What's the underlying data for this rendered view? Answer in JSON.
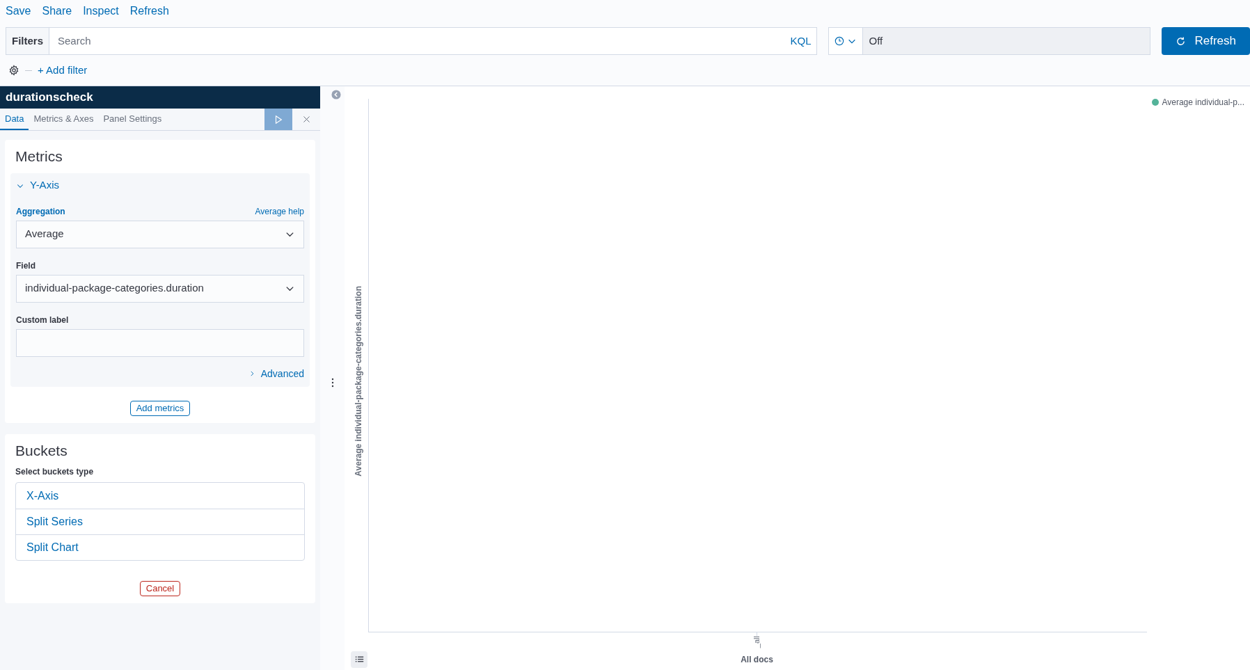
{
  "top_menu": [
    "Save",
    "Share",
    "Inspect",
    "Refresh"
  ],
  "query_bar": {
    "filters_label": "Filters",
    "placeholder": "Search",
    "language": "KQL",
    "refresh_interval": "Off",
    "refresh_button": "Refresh"
  },
  "add_filter": "+ Add filter",
  "editor": {
    "title": "durationscheck",
    "tabs": [
      {
        "label": "Data",
        "selected": true
      },
      {
        "label": "Metrics & Axes",
        "selected": false
      },
      {
        "label": "Panel Settings",
        "selected": false
      }
    ],
    "apply_disabled": true,
    "metrics": {
      "heading": "Metrics",
      "agg_title": "Y-Axis",
      "expanded": true,
      "aggregation_label": "Aggregation",
      "help_link": "Average help",
      "aggregation": "Average",
      "field_label": "Field",
      "field": "individual-package-categories.duration",
      "custom_label_label": "Custom label",
      "advanced": "Advanced",
      "advanced_expanded": false,
      "add_button": "Add metrics"
    },
    "buckets": {
      "heading": "Buckets",
      "type_label": "Select buckets type",
      "options": [
        "X-Axis",
        "Split Series",
        "Split Chart"
      ],
      "cancel": "Cancel"
    }
  },
  "chart": {
    "legend": [
      {
        "label": "Average individual-p...",
        "color": "#54b399"
      }
    ],
    "y_title": "Average individual-package-categories.duration",
    "x_tick": "_all",
    "x_title": "All docs"
  }
}
